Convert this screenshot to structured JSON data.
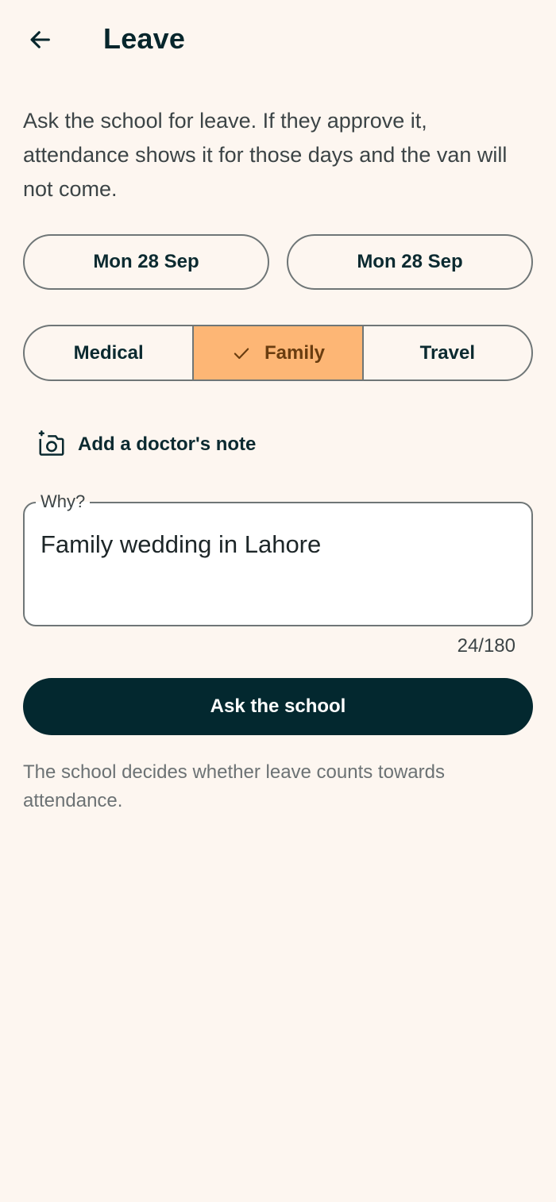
{
  "header": {
    "back_icon": "arrow-left-icon",
    "title": "Leave"
  },
  "intro": "Ask the school for leave. If they approve it, attendance shows it for those days and the van will not come.",
  "dates": {
    "start": "Mon 28 Sep",
    "end": "Mon 28 Sep"
  },
  "reasons": {
    "options": [
      "Medical",
      "Family",
      "Travel"
    ],
    "selected": "Family",
    "selected_icon": "check-icon"
  },
  "doctor_note": {
    "icon": "add-photo-camera-icon",
    "label": "Add a doctor's note"
  },
  "why_field": {
    "label": "Why?",
    "value": "Family wedding in Lahore",
    "counter": "24/180"
  },
  "submit_label": "Ask the school",
  "footnote": "The school decides whether leave counts towards attendance.",
  "colors": {
    "background": "#fdf6f0",
    "primary_dark": "#03282f",
    "selected_chip": "#fdb675",
    "selected_chip_text": "#6a3d10",
    "outline": "#6f7677"
  }
}
